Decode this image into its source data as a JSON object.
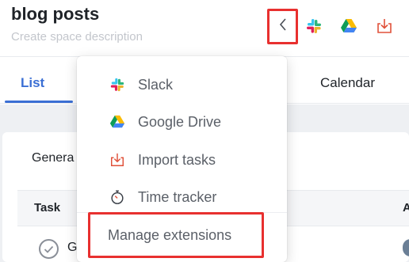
{
  "header": {
    "title": "blog posts",
    "description_placeholder": "Create space description"
  },
  "toolbar": {
    "icons": [
      "chevron-left-icon",
      "slack-icon",
      "google-drive-icon",
      "import-tasks-icon"
    ]
  },
  "tabs": [
    {
      "label": "List",
      "active": true
    },
    {
      "label": "Calendar",
      "active": false
    }
  ],
  "content": {
    "group_label": "Genera",
    "columns": [
      "Task",
      "A"
    ],
    "row_text": "G"
  },
  "extensions_menu": {
    "items": [
      {
        "label": "Slack",
        "icon": "slack-icon"
      },
      {
        "label": "Google Drive",
        "icon": "google-drive-icon"
      },
      {
        "label": "Import tasks",
        "icon": "import-tasks-icon"
      },
      {
        "label": "Time tracker",
        "icon": "stopwatch-icon"
      }
    ],
    "manage_label": "Manage extensions"
  },
  "colors": {
    "accent": "#3b6fd4",
    "highlight": "#e8302f",
    "muted_text": "#5b6068",
    "placeholder": "#c3c6cc"
  }
}
